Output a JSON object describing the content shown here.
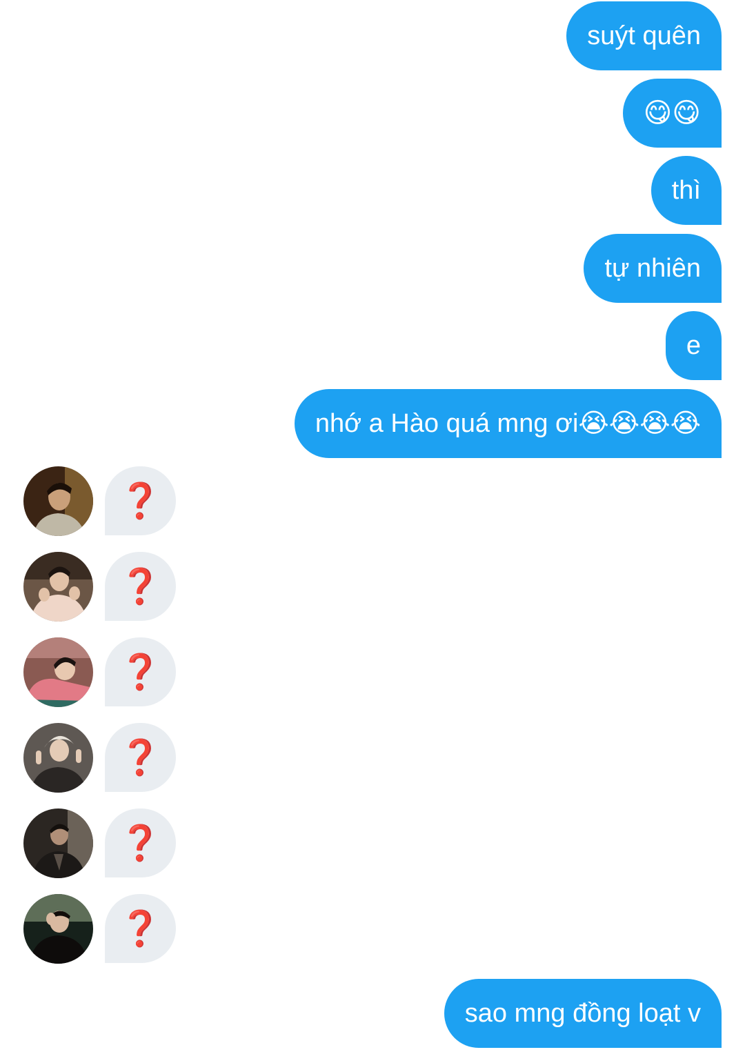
{
  "messages_out": [
    {
      "text": "suýt quên"
    },
    {
      "text": "😋😋"
    },
    {
      "text": "thì"
    },
    {
      "text": "tự nhiên"
    },
    {
      "text": "e"
    },
    {
      "text": "nhớ a Hào quá mng ơi😭😭😭😭"
    },
    {
      "text": "sao mng đồng loạt v"
    }
  ],
  "messages_in": [
    {
      "text": "❓",
      "avatar_icon": "avatar-photo"
    },
    {
      "text": "❓",
      "avatar_icon": "avatar-photo"
    },
    {
      "text": "❓",
      "avatar_icon": "avatar-photo"
    },
    {
      "text": "❓",
      "avatar_icon": "avatar-photo"
    },
    {
      "text": "❓",
      "avatar_icon": "avatar-photo"
    },
    {
      "text": "❓",
      "avatar_icon": "avatar-photo"
    }
  ],
  "colors": {
    "outgoing_bubble": "#1da1f2",
    "incoming_bubble": "#e9edf1",
    "question_mark": "#d32f2f"
  }
}
